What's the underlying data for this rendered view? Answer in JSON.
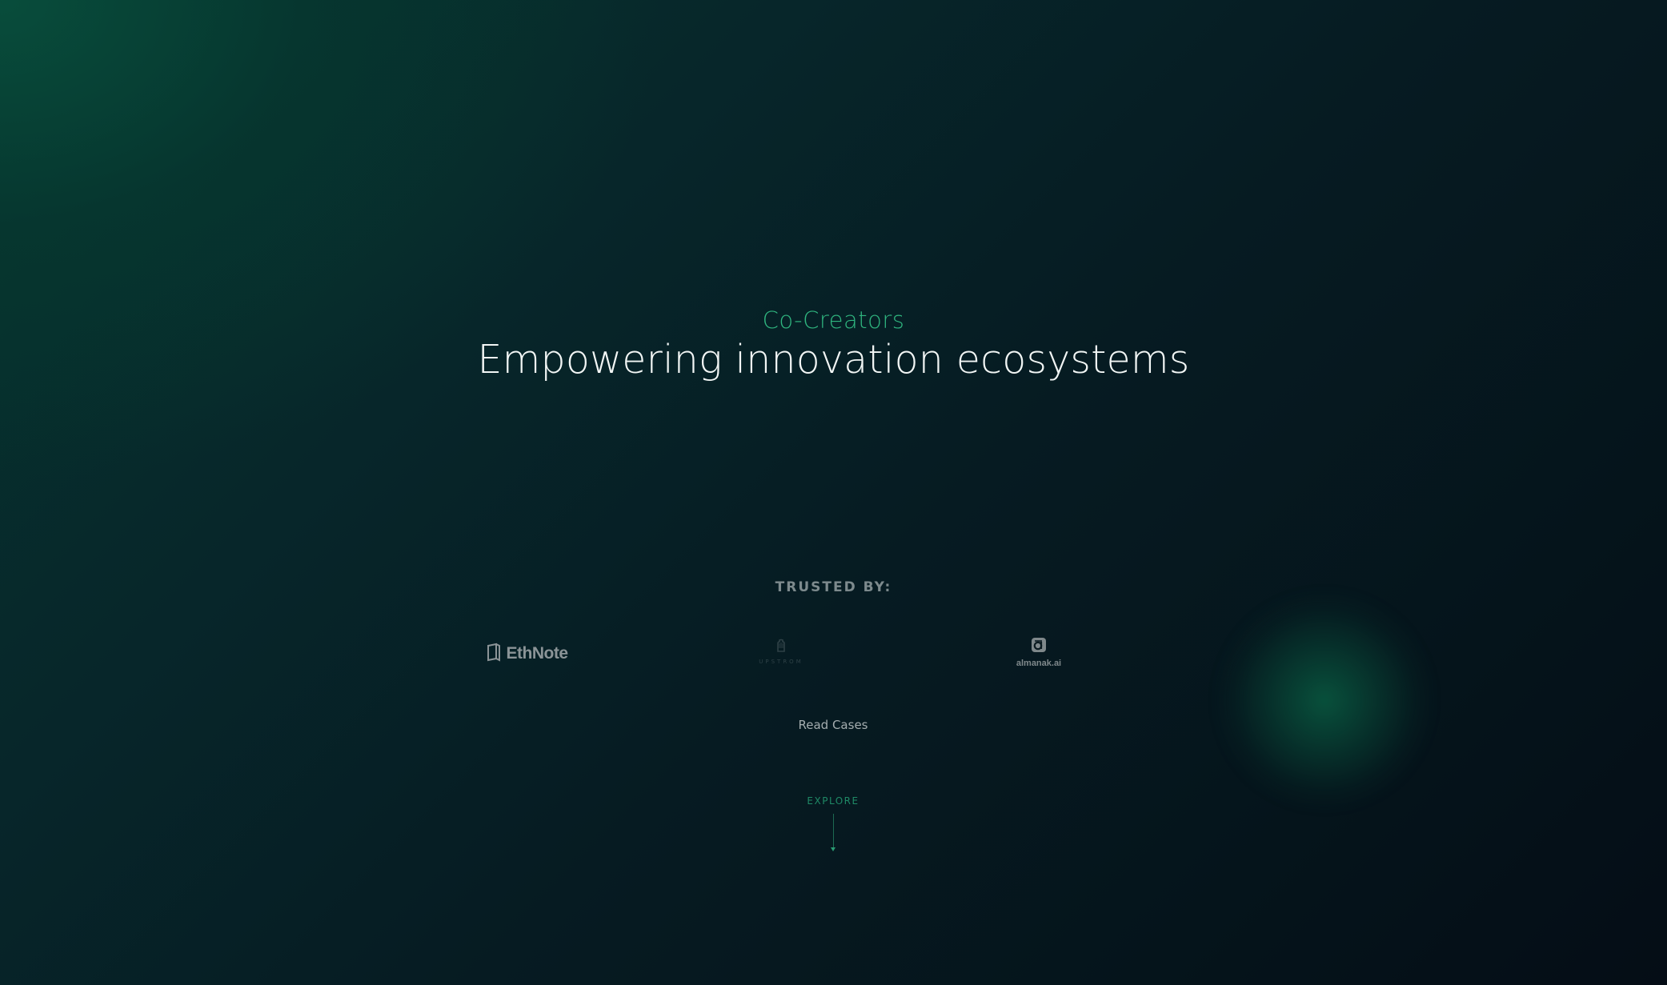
{
  "hero": {
    "eyebrow": "Co-Creators",
    "headline": "Empowering innovation ecosystems"
  },
  "trusted": {
    "label": "TRUSTED BY:",
    "logos": [
      {
        "name": "EthNote",
        "icon": "book-icon"
      },
      {
        "name": "UPSTROM",
        "icon": "hand-icon"
      },
      {
        "name": "almanak.ai",
        "icon": "almanak-a-icon"
      }
    ]
  },
  "cta": {
    "read_cases": "Read Cases"
  },
  "explore": {
    "label": "EXPLORE",
    "icon": "arrow-down-icon"
  },
  "colors": {
    "accent": "#2fb57f",
    "headline": "#f2f6f5",
    "muted": "#7d8a8d",
    "background_dark": "#05141b",
    "background_green": "#06352f"
  }
}
